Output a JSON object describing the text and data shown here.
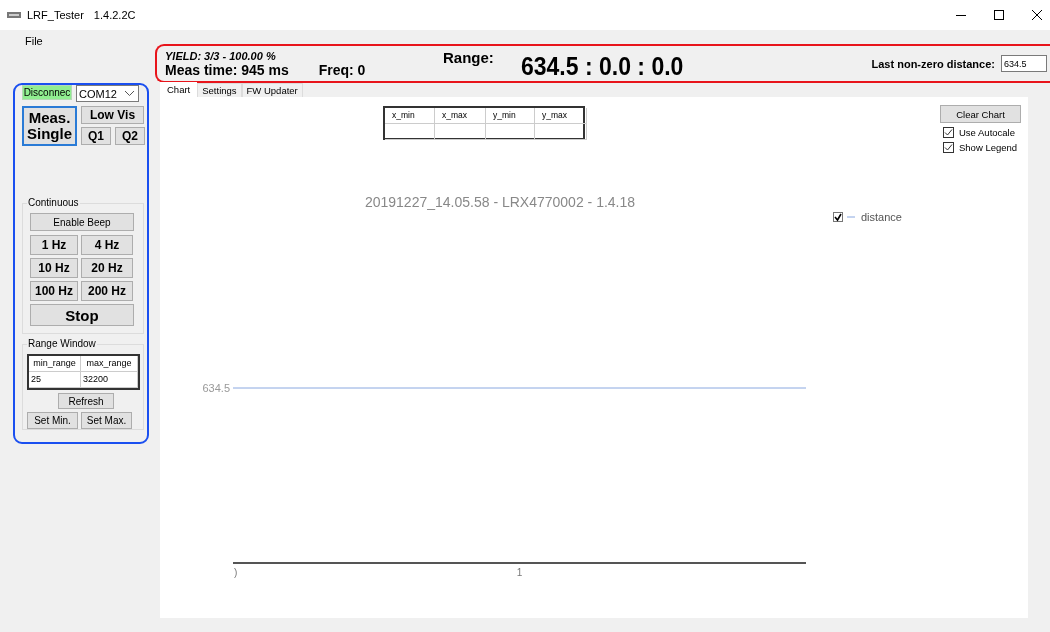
{
  "window": {
    "title": "LRF_Tester",
    "version": "1.4.2.2C"
  },
  "menu": [
    "File"
  ],
  "controls": {
    "connect_button": {
      "label": "Disconnec",
      "active": true
    },
    "port_select": {
      "value": "COM12"
    },
    "single_button": {
      "label": "Meas. Single",
      "focused": true
    },
    "low_vis_button": "Low Vis",
    "q_buttons": [
      "Q1",
      "Q2"
    ]
  },
  "continuous": {
    "title": "Continuous",
    "beep_button": "Enable Beep",
    "rate_buttons": [
      "1 Hz",
      "4 Hz",
      "10 Hz",
      "20 Hz",
      "100 Hz",
      "200 Hz"
    ],
    "stop_button": "Stop"
  },
  "range_window": {
    "title": "Range Window",
    "columns": [
      "min_range",
      "max_range"
    ],
    "values": [
      "25",
      "32200"
    ],
    "refresh_button": "Refresh",
    "buttons": [
      "Set Min.",
      "Set Max."
    ]
  },
  "status": {
    "yield": "YIELD: 3/3 - 100.00 %",
    "meas_time": "Meas time: 945 ms",
    "freq": "Freq: 0",
    "range_label": "Range:",
    "range_value": "634.5 : 0.0 : 0.0",
    "last_label": "Last non-zero distance:",
    "last_value": "634.5"
  },
  "tabs": [
    {
      "label": "Chart",
      "selected": true
    },
    {
      "label": "Settings",
      "selected": false
    },
    {
      "label": "FW Updater",
      "selected": false
    }
  ],
  "limits_table": {
    "columns": [
      "x_min",
      "x_max",
      "y_min",
      "y_max"
    ]
  },
  "clear_button": "Clear Chart",
  "options": [
    {
      "label": "Use Autocale",
      "checked": true
    },
    {
      "label": "Show Legend",
      "checked": true
    }
  ],
  "chart": {
    "title": "20191227_14.05.58 - LRX4770002 - 1.4.18",
    "y_tick_label": "634.5",
    "x_tick_labels": [
      ")",
      "1"
    ],
    "legend": {
      "label": "distance",
      "checked": true
    }
  }
}
